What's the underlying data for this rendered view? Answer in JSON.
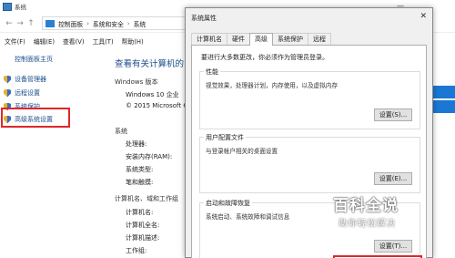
{
  "window": {
    "title": "系统",
    "minimize_glyph": "—"
  },
  "address_bar": {
    "back_glyph": "←",
    "forward_glyph": "→",
    "up_glyph": "↑",
    "crumbs": [
      "控制面板",
      "系统和安全",
      "系统"
    ],
    "separator": "›"
  },
  "menu": [
    "文件(F)",
    "编辑(E)",
    "查看(V)",
    "工具(T)",
    "帮助(H)"
  ],
  "left_pane": {
    "home": "控制面板主页",
    "tasks": [
      "设备管理器",
      "远程设置",
      "系统保护",
      "高级系统设置"
    ]
  },
  "main_pane": {
    "heading": "查看有关计算机的",
    "edition_section": "Windows 版本",
    "edition_name": "Windows 10 企业",
    "copyright": "© 2015 Microsoft C",
    "system_section": "系统",
    "system_rows": [
      "处理器:",
      "安装内存(RAM):",
      "系统类型:",
      "笔和触摸:"
    ],
    "computer_section": "计算机名、域和工作组",
    "computer_rows": [
      "计算机名:",
      "计算机全名:",
      "计算机描述:",
      "工作组:"
    ]
  },
  "dialog": {
    "title": "系统属性",
    "close_glyph": "✕",
    "tabs": [
      "计算机名",
      "硬件",
      "高级",
      "系统保护",
      "远程"
    ],
    "active_tab": "高级",
    "admin_note": "要进行大多数更改，你必须作为管理员登录。",
    "groups": [
      {
        "title": "性能",
        "desc": "视觉效果，处理器计划，内存使用，以及虚拟内存",
        "button": "设置(S)..."
      },
      {
        "title": "用户配置文件",
        "desc": "与登录帐户相关的桌面设置",
        "button": "设置(E)..."
      },
      {
        "title": "启动和故障恢复",
        "desc": "系统启动、系统故障和调试信息",
        "button": "设置(T)..."
      }
    ]
  },
  "watermark": {
    "brand": "百科全说",
    "slogan": "助你轻松解决"
  },
  "colors": {
    "link": "#1a4f8c",
    "highlight": "#e0262a",
    "windows_blue": "#1a77d4"
  }
}
